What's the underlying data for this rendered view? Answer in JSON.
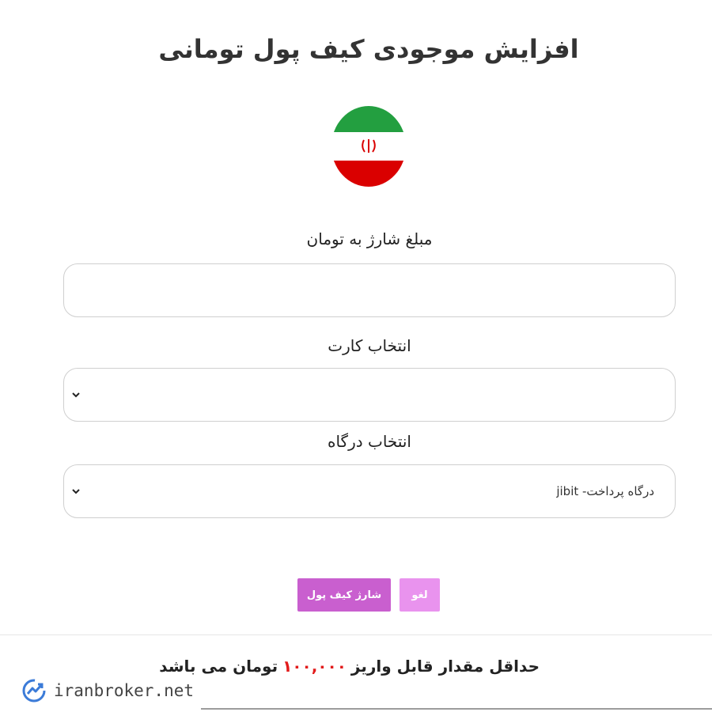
{
  "page": {
    "title": "افزایش موجودی کیف پول تومانی"
  },
  "form": {
    "amount_label": "مبلغ شارژ به تومان",
    "amount_value": "",
    "card_label": "انتخاب کارت",
    "card_selected": "",
    "gateway_label": "انتخاب درگاه",
    "gateway_selected": "درگاه پرداخت- jibit"
  },
  "actions": {
    "charge_label": "شارژ کیف پول",
    "cancel_label": "لغو"
  },
  "footer": {
    "min_prefix": "حداقل مقدار قابل واریز",
    "min_amount": "۱۰۰,۰۰۰",
    "min_suffix": "تومان می باشد"
  },
  "watermark": {
    "text": "iranbroker.net"
  },
  "colors": {
    "flag_green": "#239f40",
    "flag_red": "#da0000",
    "charge_button": "#c95fcf",
    "cancel_button": "#e993ee",
    "min_amount": "#e21b1b"
  },
  "icons": {
    "flag": "iran-flag-icon",
    "select_arrow": "chevron-down-icon",
    "watermark": "iranbroker-logo-icon"
  }
}
